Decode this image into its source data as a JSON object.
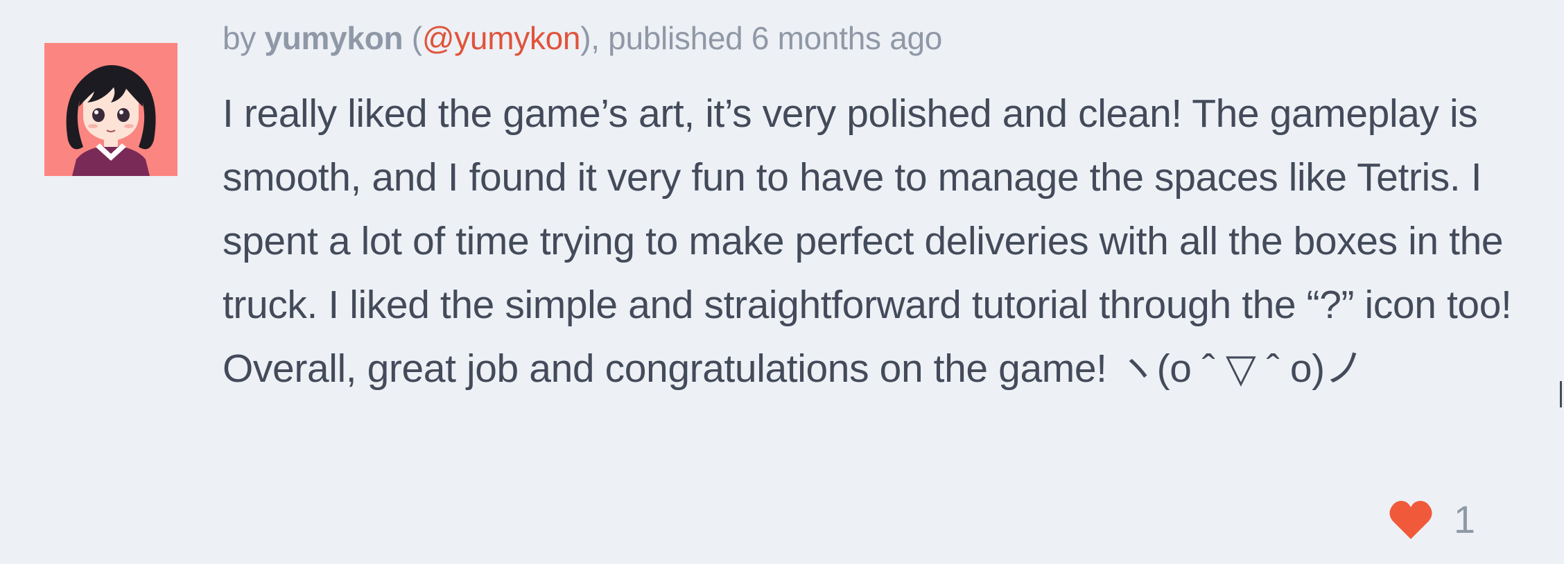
{
  "comment": {
    "meta": {
      "prefix": "by ",
      "author": "yumykon",
      "handle_open": " (",
      "handle": "@yumykon",
      "published": "), published 6 months ago"
    },
    "body": "I really liked the game’s art, it’s very polished and clean! The gameplay is smooth, and I found it very fun to have to manage the spaces like Tetris. I spent a lot of time trying to make perfect deliveries with all the boxes in the truck. I liked the simple and straightforward tutorial through the “?” icon too! Overall, great job and congratulations on the game! ヽ(o ˆ ▽ ˆ o)ノ",
    "likes": {
      "icon": "heart-icon",
      "count": "1",
      "color": "#f05a3a"
    },
    "avatar": {
      "background": "#fb8580"
    }
  }
}
